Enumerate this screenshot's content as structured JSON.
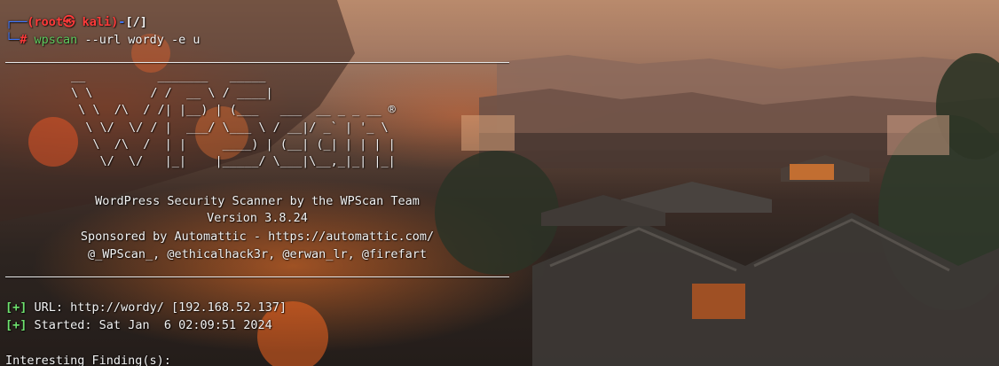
{
  "prompt": {
    "corner_top": "┌──",
    "user_host": "(root㉿ kali)",
    "dash": "-",
    "cwd": "[/]",
    "corner_bottom": "└─",
    "hash": "#",
    "command_name": "wpscan",
    "command_flag": "--url",
    "command_args": "wordy -e u"
  },
  "banner": {
    "ascii_art": "__          _______   _____\n\\ \\        / /  __ \\ / ____|\n \\ \\  /\\  / /| |__) | (___   ___  __ _ _ __ ®\n  \\ \\/  \\/ / |  ___/ \\___ \\ / __|/ _` | '_ \\\n   \\  /\\  /  | |     ____) | (__| (_| | | | |\n    \\/  \\/   |_|    |_____/ \\___|\\__,_|_| |_|",
    "tagline": "WordPress Security Scanner by the WPScan Team",
    "version": "Version 3.8.24",
    "sponsor": "Sponsored by Automattic - https://automattic.com/",
    "credits": "@_WPScan_, @ethicalhack3r, @erwan_lr, @firefart"
  },
  "results": {
    "url_tag": "[+]",
    "url_text": "URL: http://wordy/ [192.168.52.137]",
    "started_tag": "[+]",
    "started_text": "Started: Sat Jan  6 02:09:51 2024",
    "findings_heading": "Interesting Finding(s):"
  },
  "colors": {
    "prompt_blue": "#3f78ff",
    "prompt_red": "#ff3a3a",
    "status_green": "#6fe36f"
  }
}
